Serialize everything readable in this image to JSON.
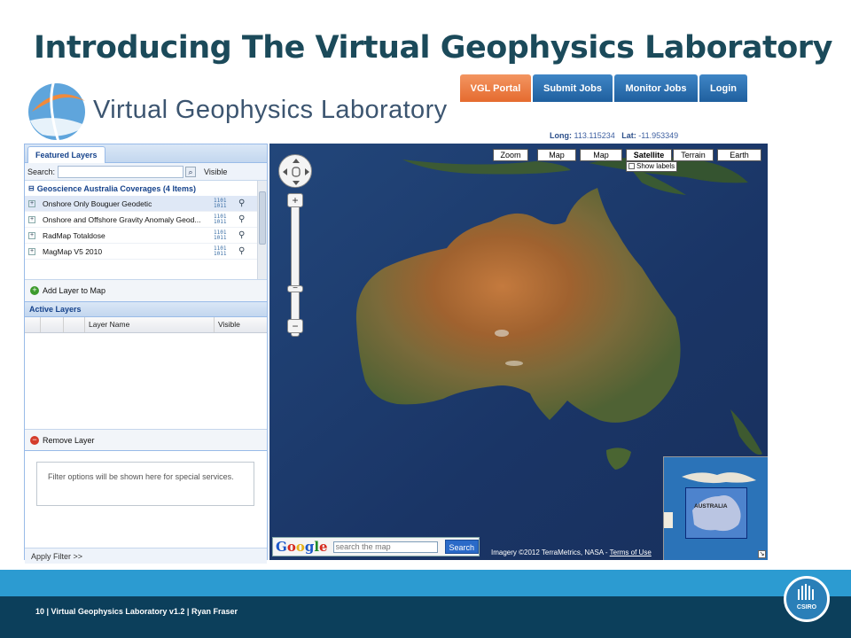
{
  "slide": {
    "title": "Introducing The Virtual Geophysics Laboratory",
    "footer": "10  |  Virtual Geophysics Laboratory v1.2 | Ryan Fraser",
    "csiro_logo_text": "CSIRO"
  },
  "app": {
    "logo_text": "Virtual Geophysics Laboratory",
    "nav": [
      {
        "label": "VGL Portal",
        "active": true
      },
      {
        "label": "Submit Jobs",
        "active": false
      },
      {
        "label": "Monitor Jobs",
        "active": false
      },
      {
        "label": "Login",
        "active": false
      }
    ],
    "coords": {
      "long_label": "Long:",
      "long": "113.115234",
      "lat_label": "Lat:",
      "lat": "-11.953349"
    }
  },
  "left_panel": {
    "tab": "Featured Layers",
    "search_label": "Search:",
    "search_value": "",
    "visible_header": "Visible",
    "group": "Geoscience Australia Coverages (4 Items)",
    "layers": [
      {
        "name": "Onshore Only Bouguer Geodetic",
        "selected": true
      },
      {
        "name": "Onshore and Offshore Gravity Anomaly Geod...",
        "selected": false
      },
      {
        "name": "RadMap Totaldose",
        "selected": false
      },
      {
        "name": "MagMap V5 2010",
        "selected": false
      }
    ],
    "add_layer": "Add Layer to Map",
    "active_layers_title": "Active Layers",
    "grid_columns": {
      "layer_name": "Layer Name",
      "visible": "Visible"
    },
    "remove_layer": "Remove Layer",
    "filter_text": "Filter options will be shown here for special services.",
    "apply_filter": "Apply Filter >>"
  },
  "map": {
    "types": [
      {
        "label": "Zoom",
        "selected": false
      },
      {
        "label": "Map",
        "selected": false
      },
      {
        "label": "Map",
        "selected": false
      },
      {
        "label": "Satellite",
        "selected": true
      },
      {
        "label": "Terrain",
        "selected": false
      },
      {
        "label": "Earth",
        "selected": false
      }
    ],
    "show_labels": "Show labels",
    "search_placeholder": "search the map",
    "search_button": "Search",
    "google_logo": "Google",
    "imagery_credit": "Imagery ©2012 TerraMetrics, NASA - ",
    "terms": "Terms of Use",
    "overview_label": "AUSTRALIA",
    "colors": {
      "ocean": "#1d3a6b",
      "land_center": "#b8692f",
      "land_edge": "#5a6a3c"
    }
  }
}
